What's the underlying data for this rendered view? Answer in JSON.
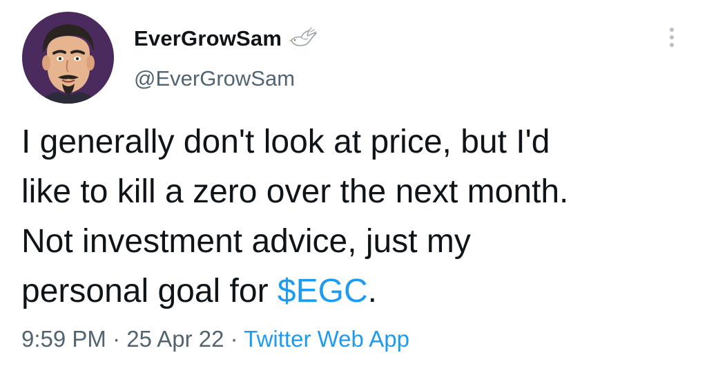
{
  "author": {
    "display_name": "EverGrowSam",
    "handle": "@EverGrowSam",
    "avatar_icon": "avatar-cartoon-man",
    "badge_icon": "dove-icon"
  },
  "tweet": {
    "line1": "I generally don't look at price, but I'd",
    "line2": "like to kill a zero over the next month.",
    "line3": "Not investment advice, just my",
    "line4_prefix": "personal goal for ",
    "cashtag": "$EGC",
    "line4_suffix": "."
  },
  "meta": {
    "time": "9:59 PM",
    "separator": " · ",
    "date": "25 Apr 22",
    "source": "Twitter Web App"
  },
  "colors": {
    "text": "#0f1419",
    "secondary": "#536471",
    "link": "#1d9bf0"
  }
}
